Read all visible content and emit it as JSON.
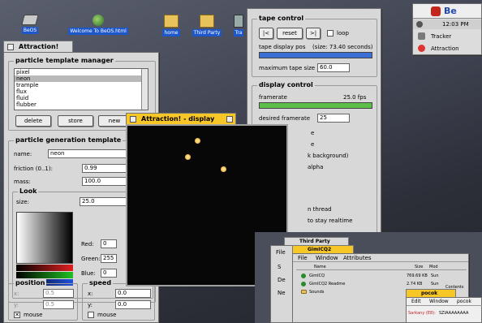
{
  "desktop": {
    "icons": [
      {
        "label": "BeOS"
      },
      {
        "label": "Welcome To BeOS.html"
      },
      {
        "label": "home"
      },
      {
        "label": "Third Party"
      },
      {
        "label": "Tra"
      }
    ]
  },
  "deskbar": {
    "logo": "Be",
    "time": "12:03 PM",
    "items": [
      {
        "label": "Tracker"
      },
      {
        "label": "Attraction"
      }
    ]
  },
  "attraction_window": {
    "title": "Attraction!",
    "template_manager": {
      "title": "particle template manager",
      "items": [
        "pixel",
        "neon",
        "trample",
        "flux",
        "fluid",
        "flubber"
      ],
      "selected": "neon",
      "delete": "delete",
      "store": "store",
      "new": "new"
    },
    "generation": {
      "title": "particle generation template",
      "name_label": "name:",
      "name_value": "neon",
      "friction_label": "friction (0..1):",
      "friction_value": "0.99",
      "mass_label": "mass:",
      "mass_value": "100.0"
    },
    "look": {
      "title": "Look",
      "size_label": "size:",
      "size_value": "25.0",
      "red_label": "Red:",
      "red_value": "0",
      "green_label": "Green:",
      "green_value": "255",
      "blue_label": "Blue:",
      "blue_value": "0"
    },
    "position": {
      "title": "position",
      "x_label": "x:",
      "x_value": "0.5",
      "y_label": "y:",
      "y_value": "0.5",
      "mouse": "mouse",
      "mouse_checked": true
    },
    "speed": {
      "title": "speed",
      "x_label": "x:",
      "x_value": "0.0",
      "y_label": "y:",
      "y_value": "0.0",
      "mouse": "mouse",
      "mouse_checked": false
    }
  },
  "display_window": {
    "title": "Attraction! - display"
  },
  "control_window": {
    "tape": {
      "title": "tape control",
      "rewind": "|<",
      "reset": "reset",
      "forward": ">|",
      "loop": "loop",
      "pos_label": "tape display pos",
      "pos_info": "(size: 73.40 seconds)",
      "max_label": "maximum tape size",
      "max_value": "60.0"
    },
    "display": {
      "title": "display control",
      "framerate_label": "framerate",
      "framerate_value": "25.0 fps",
      "desired_label": "desired framerate",
      "desired_value": "25",
      "partial": [
        "e",
        "e",
        "k background)",
        "alpha",
        "n thread",
        "to stay realtime"
      ]
    }
  },
  "tracker_window": {
    "folder_title": "Third Party",
    "title": "GimICQ2",
    "menu": [
      "File",
      "Window",
      "Attributes"
    ],
    "columns": [
      "Name",
      "Size",
      "Mod"
    ],
    "rows": [
      {
        "name": "GimICQ",
        "size": "769.69 KB",
        "mod": "Sun"
      },
      {
        "name": "GimICQ2 Readme",
        "size": "2.74 KB",
        "mod": "Sun"
      },
      {
        "name": "Sounds",
        "size": "",
        "mod": ""
      }
    ],
    "side_labels": [
      "File",
      "S",
      "De",
      "Ne"
    ],
    "back_label": "Contents"
  },
  "pocok": {
    "title": "pocok",
    "menu": [
      "Edit",
      "Window",
      "pocok"
    ],
    "line_name": "Sarkany (E8):",
    "line_text": "SZIAAAAAAAA"
  }
}
